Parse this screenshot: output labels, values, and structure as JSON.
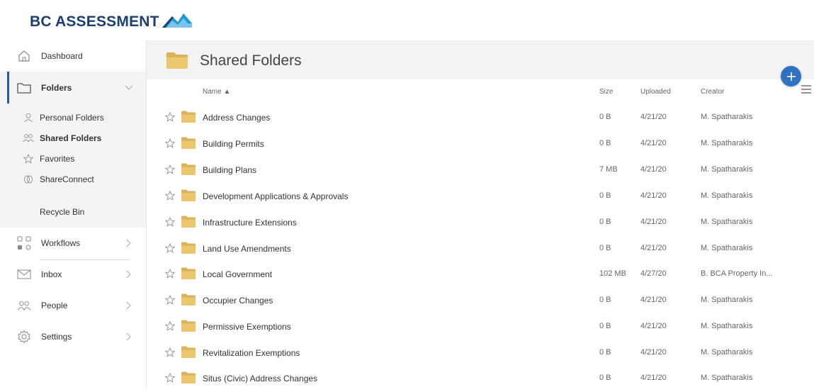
{
  "brand": {
    "name": "BC ASSESSMENT",
    "text_color": "#1b3f73",
    "mark_colors": [
      "#1b3f73",
      "#1e9ad6",
      "#7cc4ec"
    ]
  },
  "nav": {
    "dashboard": "Dashboard",
    "folders": "Folders",
    "sub": {
      "personal": "Personal Folders",
      "shared": "Shared Folders",
      "favorites": "Favorites",
      "shareconnect": "ShareConnect",
      "recycle": "Recycle Bin"
    },
    "workflows": "Workflows",
    "inbox": "Inbox",
    "people": "People",
    "settings": "Settings",
    "active_color": "#1d5fa8"
  },
  "main": {
    "title": "Shared Folders",
    "columns": {
      "name": "Name ▲",
      "size": "Size",
      "uploaded": "Uploaded",
      "creator": "Creator"
    },
    "folder_color": "#e9c46a",
    "fab_color": "#2f72c4",
    "rows": [
      {
        "name": "Address Changes",
        "size": "0 B",
        "uploaded": "4/21/20",
        "creator": "M. Spatharakis"
      },
      {
        "name": "Building Permits",
        "size": "0 B",
        "uploaded": "4/21/20",
        "creator": "M. Spatharakis"
      },
      {
        "name": "Building Plans",
        "size": "7 MB",
        "uploaded": "4/21/20",
        "creator": "M. Spatharakis"
      },
      {
        "name": "Development Applications & Approvals",
        "size": "0 B",
        "uploaded": "4/21/20",
        "creator": "M. Spatharakis"
      },
      {
        "name": "Infrastructure Extensions",
        "size": "0 B",
        "uploaded": "4/21/20",
        "creator": "M. Spatharakis"
      },
      {
        "name": "Land Use Amendments",
        "size": "0 B",
        "uploaded": "4/21/20",
        "creator": "M. Spatharakis"
      },
      {
        "name": "Local Government",
        "size": "102 MB",
        "uploaded": "4/27/20",
        "creator": "B. BCA Property In..."
      },
      {
        "name": "Occupier Changes",
        "size": "0 B",
        "uploaded": "4/21/20",
        "creator": "M. Spatharakis"
      },
      {
        "name": "Permissive Exemptions",
        "size": "0 B",
        "uploaded": "4/21/20",
        "creator": "M. Spatharakis"
      },
      {
        "name": "Revitalization Exemptions",
        "size": "0 B",
        "uploaded": "4/21/20",
        "creator": "M. Spatharakis"
      },
      {
        "name": "Situs (Civic) Address Changes",
        "size": "0 B",
        "uploaded": "4/21/20",
        "creator": "M. Spatharakis"
      }
    ]
  }
}
